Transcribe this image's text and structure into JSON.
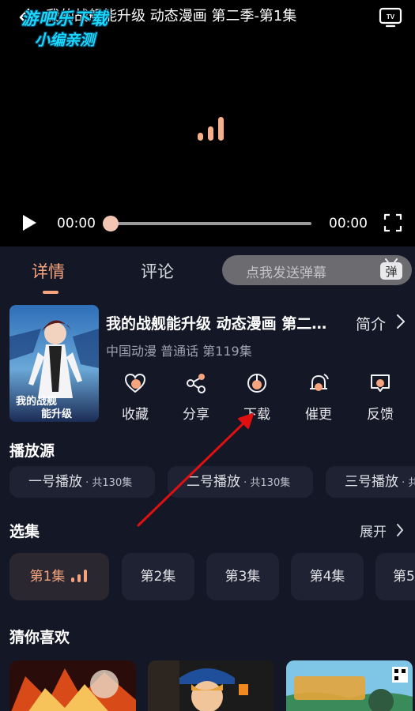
{
  "player": {
    "title": "我的战舰能升级 动态漫画 第二季-第1集",
    "current_time": "00:00",
    "total_time": "00:00",
    "progress": 0
  },
  "watermark": {
    "line1": "游吧乐下载",
    "line2": "小编亲测"
  },
  "tabs": {
    "detail": "详情",
    "comment": "评论",
    "danmaku_placeholder": "点我发送弹幕",
    "danmaku_icon_text": "弹"
  },
  "anime": {
    "title": "我的战舰能升级 动态漫画 第二…",
    "intro": "简介",
    "meta": "中国动漫 普通话 第119集",
    "poster_text_1": "我的战舰",
    "poster_text_2": "能升级"
  },
  "actions": [
    {
      "label": "收藏",
      "icon": "heart-icon"
    },
    {
      "label": "分享",
      "icon": "share-icon"
    },
    {
      "label": "下载",
      "icon": "download-icon"
    },
    {
      "label": "催更",
      "icon": "bell-icon"
    },
    {
      "label": "反馈",
      "icon": "feedback-icon"
    }
  ],
  "source": {
    "title": "播放源",
    "items": [
      {
        "name": "一号播放",
        "count": " · 共130集"
      },
      {
        "name": "二号播放",
        "count": " · 共130集"
      },
      {
        "name": "三号播放",
        "count": " · 共"
      }
    ]
  },
  "episodes": {
    "title": "选集",
    "expand": "展开",
    "items": [
      "第1集",
      "第2集",
      "第3集",
      "第4集",
      "第5"
    ]
  },
  "recommend": {
    "title": "猜你喜欢"
  },
  "colors": {
    "accent": "#f5a47e",
    "background": "#141726",
    "card": "#1e2233",
    "annotation_arrow": "#e01010"
  }
}
